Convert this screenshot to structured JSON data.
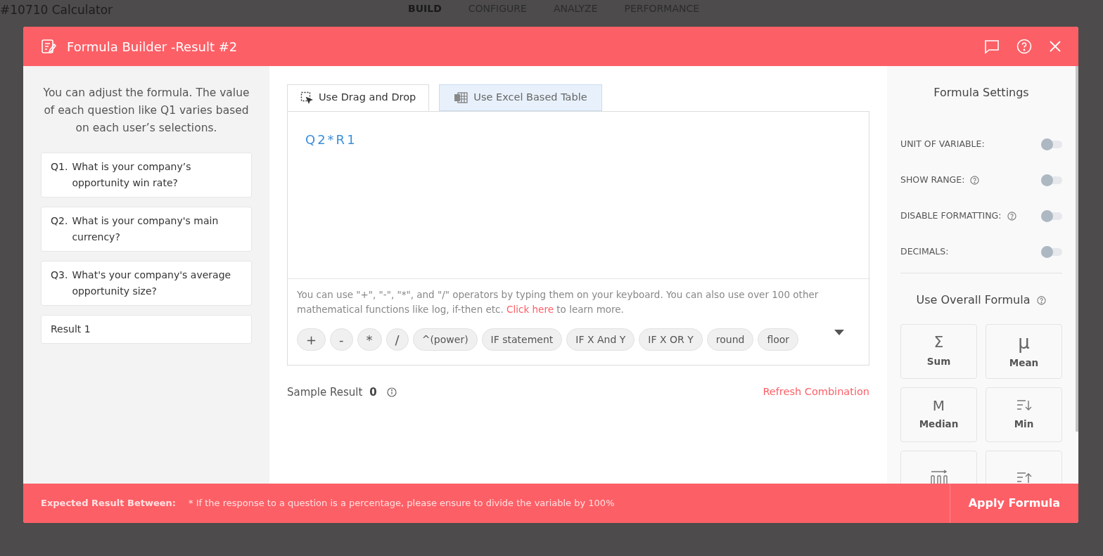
{
  "background": {
    "title": "#10710 Calculator",
    "nav": [
      {
        "label": "BUILD",
        "selected": true
      },
      {
        "label": "CONFIGURE",
        "selected": false
      },
      {
        "label": "ANALYZE",
        "selected": false
      },
      {
        "label": "PERFORMANCE",
        "selected": false
      }
    ]
  },
  "modal": {
    "title": "Formula Builder -Result #2"
  },
  "questions_panel": {
    "intro": "You can adjust the formula. The value of each question like Q1 varies based on each user’s selections.",
    "items": [
      {
        "number": "Q1.",
        "text": "What is your company’s opportunity win rate?"
      },
      {
        "number": "Q2.",
        "text": "What is your company's main currency?"
      },
      {
        "number": "Q3.",
        "text": "What's your company's average opportunity size?"
      },
      {
        "text": "Result 1"
      }
    ]
  },
  "editor": {
    "tabs": [
      {
        "label": "Use Drag and Drop",
        "selected": true
      },
      {
        "label": "Use Excel Based Table",
        "selected": false
      }
    ],
    "formula": "Q2*R1",
    "help_before": "You can use \"+\", \"-\", \"*\", and \"/\" operators by typing them on your keyboard. You can also use over 100 other mathematical functions like log, if-then etc.",
    "help_link": "Click here",
    "help_after": "to learn more.",
    "operators": [
      "+",
      "-",
      "*",
      "/",
      "^(power)",
      "IF statement",
      "IF X And Y",
      "IF X OR Y",
      "round",
      "floor"
    ],
    "sample_label": "Sample Result",
    "sample_value": "0",
    "refresh": "Refresh Combination"
  },
  "settings": {
    "title": "Formula Settings",
    "toggles": [
      {
        "label": "UNIT OF VARIABLE:",
        "help": false,
        "on": false
      },
      {
        "label": "SHOW RANGE:",
        "help": true,
        "on": false
      },
      {
        "label": "DISABLE FORMATTING:",
        "help": true,
        "on": false
      },
      {
        "label": "DECIMALS:",
        "help": false,
        "on": false
      }
    ],
    "overall_title": "Use Overall Formula",
    "functions": [
      {
        "kind": "sum",
        "symbol": "Σ",
        "label": "Sum"
      },
      {
        "kind": "mean",
        "symbol": "μ",
        "label": "Mean"
      },
      {
        "kind": "median",
        "symbol": "M",
        "label": "Median"
      },
      {
        "kind": "min",
        "label": "Min"
      },
      {
        "kind": "average"
      },
      {
        "kind": "max"
      }
    ]
  },
  "footer": {
    "expected_label": "Expected Result Between:",
    "note": "* If the response to a question is a percentage, please ensure to divide the variable by 100%",
    "apply": "Apply Formula"
  }
}
